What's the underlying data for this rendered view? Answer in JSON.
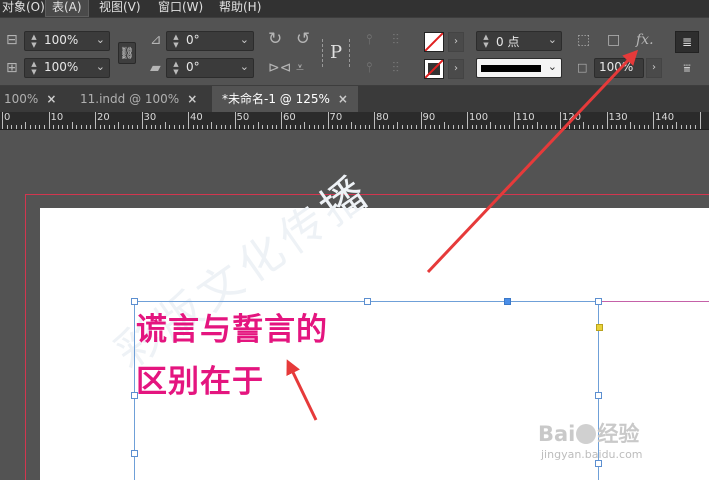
{
  "menubar": {
    "items": [
      "对象(O)",
      "表(A)",
      "视图(V)",
      "窗口(W)",
      "帮助(H)"
    ],
    "active_index": 1
  },
  "control": {
    "scale_x": "100%",
    "scale_y": "100%",
    "rotate": "0°",
    "shear": "0°",
    "stroke_weight": "0 点",
    "opacity": "100%",
    "proxy_icon": "P",
    "fx_label": "fx."
  },
  "tabs": [
    {
      "label": "100%",
      "closable": true
    },
    {
      "label": "11.indd @ 100%",
      "closable": true
    },
    {
      "label": "*未命名-1 @ 125%",
      "closable": true,
      "active": true
    }
  ],
  "tab_close_glyph": "×",
  "ruler": {
    "labels": [
      "0",
      "10",
      "20",
      "30",
      "40",
      "50",
      "60",
      "70",
      "80",
      "90",
      "100",
      "110",
      "120",
      "130",
      "140"
    ]
  },
  "document": {
    "line1": "谎言与誓言的",
    "line2": "区别在于",
    "text_color": "#e4157f",
    "watermark": "彩版文化传播"
  },
  "overlay": {
    "baidu_prefix": "Bai",
    "baidu_suffix": "经验",
    "baidu_url": "jingyan.baidu.com",
    "arrow_color": "#e63a3a"
  }
}
